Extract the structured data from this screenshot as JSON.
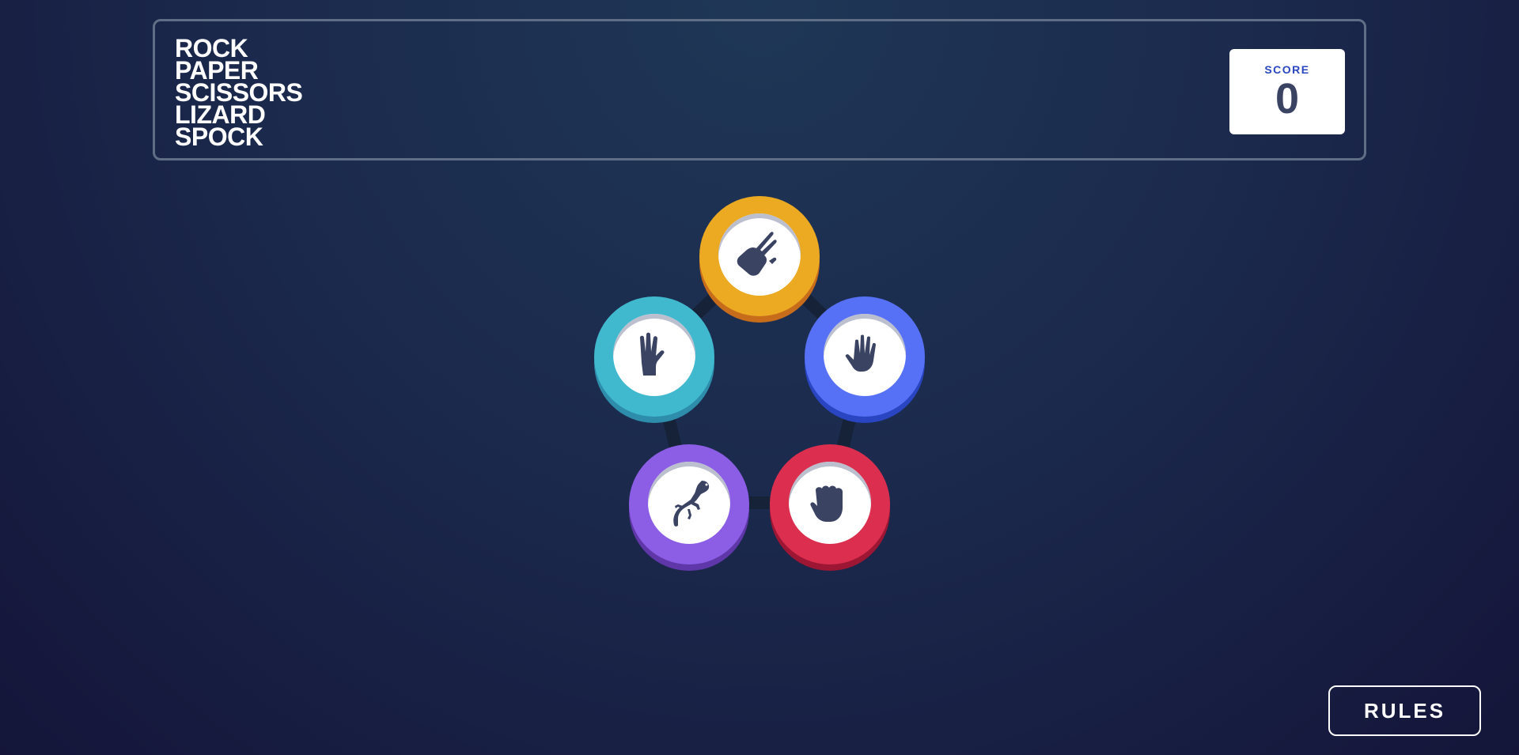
{
  "header": {
    "title_lines": [
      "ROCK",
      "PAPER",
      "SCISSORS",
      "LIZARD",
      "SPOCK"
    ],
    "score_label": "SCORE",
    "score_value": "0"
  },
  "tokens": [
    {
      "name": "scissors",
      "icon": "scissors-hand-icon",
      "color": "#eca922",
      "shadow": "#c76c1b"
    },
    {
      "name": "spock",
      "icon": "spock-hand-icon",
      "color": "#40b9ce",
      "shadow": "#2d8dab"
    },
    {
      "name": "paper",
      "icon": "paper-hand-icon",
      "color": "#5671f5",
      "shadow": "#2a45c2"
    },
    {
      "name": "lizard",
      "icon": "lizard-icon",
      "color": "#8c5de5",
      "shadow": "#5f37a8"
    },
    {
      "name": "rock",
      "icon": "rock-fist-icon",
      "color": "#dc2e4e",
      "shadow": "#9d1634"
    }
  ],
  "colors": {
    "icon": "#3b4363",
    "pentagon_line": "#162238"
  },
  "footer": {
    "rules_label": "RULES"
  }
}
